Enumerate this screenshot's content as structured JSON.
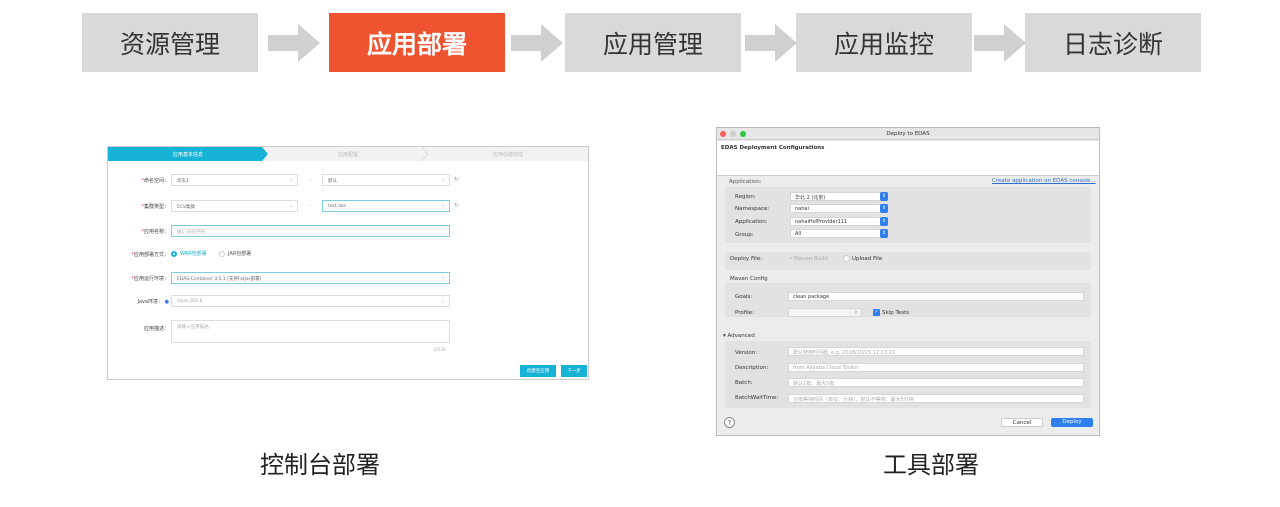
{
  "steps": [
    {
      "label": "资源管理",
      "active": false
    },
    {
      "label": "应用部署",
      "active": true
    },
    {
      "label": "应用管理",
      "active": false
    },
    {
      "label": "应用监控",
      "active": false
    },
    {
      "label": "日志诊断",
      "active": false
    }
  ],
  "colors": {
    "active": "#f0532f",
    "inactive": "#d9d9d9",
    "arrow": "#d0d0d0",
    "console_accent": "#17b3d6",
    "mac_blue": "#2f7ff0"
  },
  "console": {
    "caption": "控制台部署",
    "wizard": [
      "应用基本信息",
      "应用配置",
      "应用创建完成"
    ],
    "namespace": {
      "label": "命名空间：",
      "region": "华东1",
      "value": "默认"
    },
    "cluster": {
      "label": "集群类型：",
      "type": "ECS集群",
      "value": "test.doc"
    },
    "app_name": {
      "label": "应用名称：",
      "placeholder": "由1-36位字符"
    },
    "deploy_method": {
      "label": "应用部署方式：",
      "options": [
        "WAR包部署",
        "JAR包部署"
      ],
      "selected": "WAR包部署"
    },
    "runtime": {
      "label": "应用运行环境：",
      "value": "EDAS-Container 3.5.1 [支持FatJar部署]"
    },
    "java": {
      "label": "Java环境：",
      "value": "Open JDK 8"
    },
    "desc": {
      "label": "应用描述：",
      "placeholder": "请输入应用描述。",
      "counter": "0/128"
    },
    "buttons": {
      "create_empty": "创建空应用",
      "next": "下一步"
    }
  },
  "tool": {
    "caption": "工具部署",
    "window_title": "Deploy to EDAS",
    "header": "EDAS Deployment Configurations",
    "application_section": "Application:",
    "create_link": "Create application on EDAS console...",
    "region": {
      "label": "Region:",
      "value": "华北 2 (北京)"
    },
    "namespace": {
      "label": "Namespace:",
      "value": "nahai"
    },
    "application": {
      "label": "Application:",
      "value": "nahaiHsfProvider111"
    },
    "group": {
      "label": "Group:",
      "value": "All"
    },
    "deploy_file": {
      "label": "Deploy File:",
      "options": [
        "Maven Build",
        "Upload File"
      ]
    },
    "maven_section": "Maven Config",
    "goals": {
      "label": "Goals:",
      "value": "clean package"
    },
    "profile": {
      "label": "Profile:",
      "value": ""
    },
    "skip_tests": {
      "label": "Skip Tests",
      "checked": true
    },
    "advanced": "Advanced",
    "version": {
      "label": "Version:",
      "placeholder": "默认使用时间戳, e.g. 2018/10/15 17:13:22"
    },
    "description": {
      "label": "Description:",
      "placeholder": "from Alibaba Cloud Toolkit"
    },
    "batch": {
      "label": "Batch:",
      "placeholder": "默认1批，最大5批"
    },
    "batch_wait": {
      "label": "BatchWaitTime:",
      "placeholder": "分批等待时间（单位：分钟），默认不等待，最大5分钟"
    },
    "help": "?",
    "cancel": "Cancel",
    "deploy": "Deploy"
  }
}
